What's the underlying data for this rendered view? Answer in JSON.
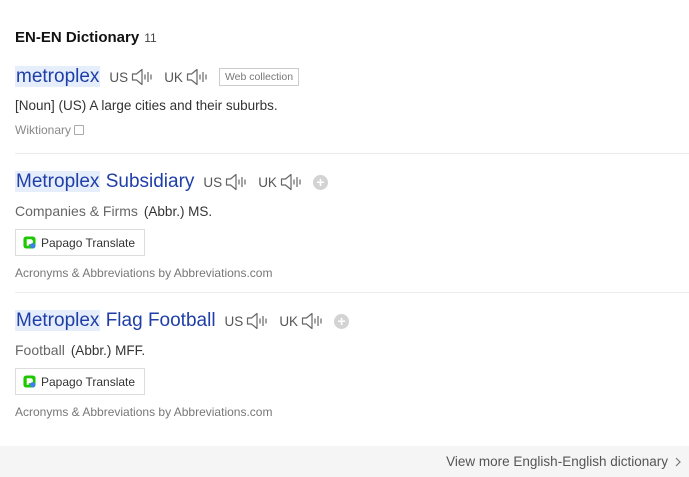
{
  "section": {
    "title": "EN-EN Dictionary",
    "count": "11"
  },
  "entries": [
    {
      "hw_highlight": "metroplex",
      "hw_rest": "",
      "us_label": "US",
      "uk_label": "UK",
      "badge": "Web collection",
      "pos": "[Noun]",
      "region": "(US)",
      "definition": "A large cities and their suburbs.",
      "source": "Wiktionary"
    },
    {
      "hw_highlight": "Metroplex",
      "hw_rest": " Subsidiary",
      "us_label": "US",
      "uk_label": "UK",
      "category": "Companies & Firms",
      "abbr_def": "(Abbr.) MS.",
      "translate_label": "Papago Translate",
      "credit": "Acronyms & Abbreviations by Abbreviations.com"
    },
    {
      "hw_highlight": "Metroplex",
      "hw_rest": " Flag Football",
      "us_label": "US",
      "uk_label": "UK",
      "category": "Football",
      "abbr_def": "(Abbr.) MFF.",
      "translate_label": "Papago Translate",
      "credit": "Acronyms & Abbreviations by Abbreviations.com"
    }
  ],
  "footer": {
    "view_more": "View more English-English dictionary"
  },
  "colors": {
    "headword": "#1f3fa8",
    "highlight": "#e6eefb",
    "footer_bg": "#f5f5f5"
  },
  "icons": [
    "speaker-icon",
    "plus-icon",
    "papago-icon",
    "chevron-right-icon"
  ]
}
